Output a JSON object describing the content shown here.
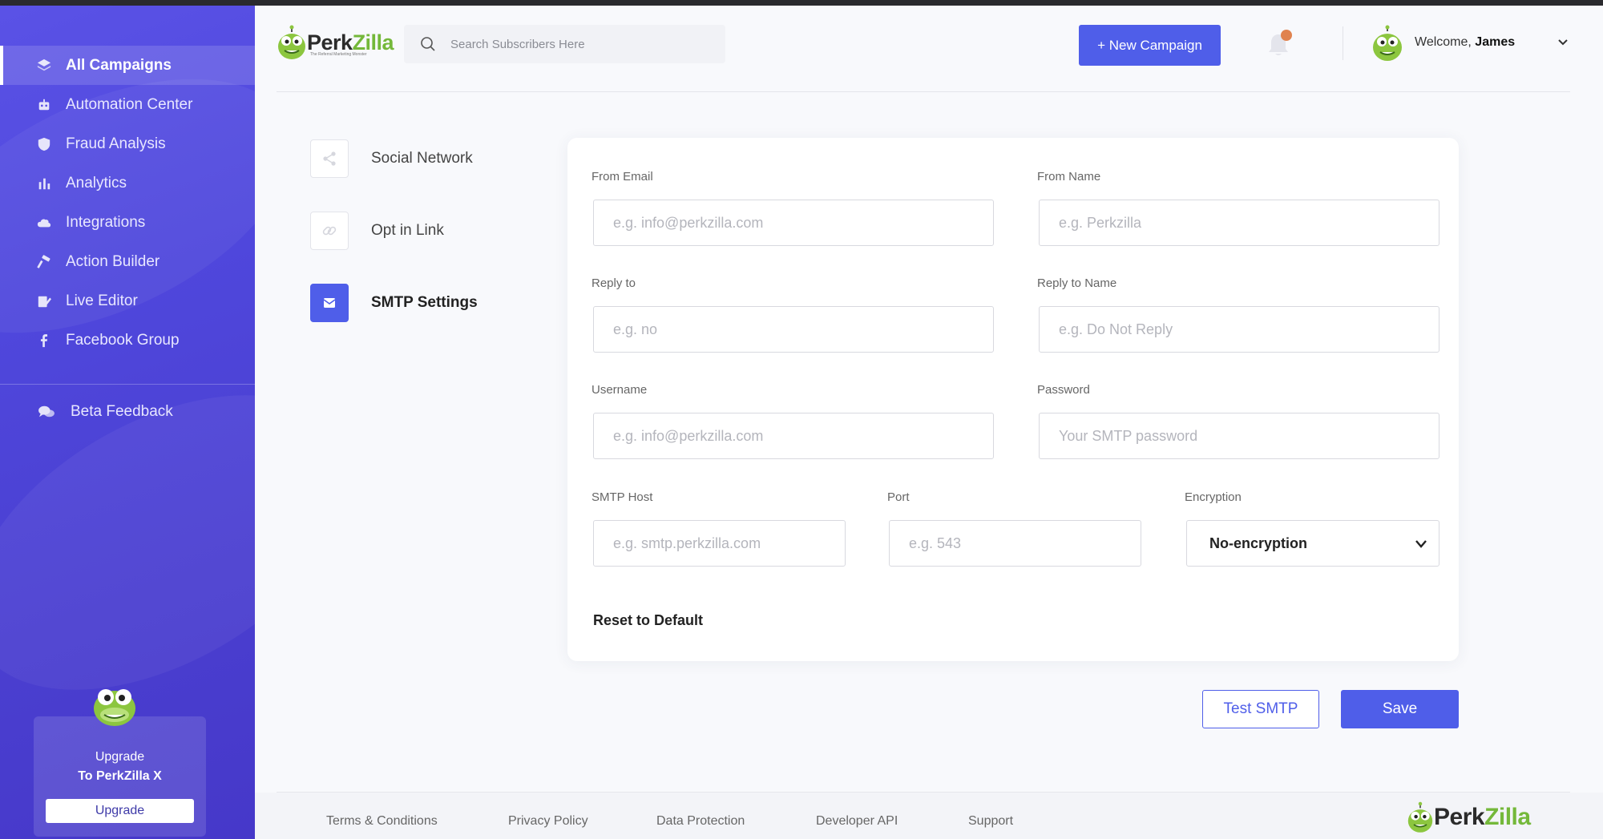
{
  "sidebar": {
    "items": [
      {
        "label": "All Campaigns",
        "icon": "layers-icon"
      },
      {
        "label": "Automation Center",
        "icon": "robot-icon"
      },
      {
        "label": "Fraud Analysis",
        "icon": "shield-icon"
      },
      {
        "label": "Analytics",
        "icon": "bar-chart-icon"
      },
      {
        "label": "Integrations",
        "icon": "cloud-icon"
      },
      {
        "label": "Action Builder",
        "icon": "hammer-icon"
      },
      {
        "label": "Live Editor",
        "icon": "edit-icon"
      },
      {
        "label": "Facebook Group",
        "icon": "facebook-icon"
      }
    ],
    "beta_label": "Beta Feedback",
    "upgrade": {
      "line1": "Upgrade",
      "line2": "To PerkZilla X",
      "button": "Upgrade"
    }
  },
  "header": {
    "logo_perk": "Perk",
    "logo_zilla": "Zilla",
    "logo_tagline": "The Referral Marketing Monster",
    "search_placeholder": "Search Subscribers Here",
    "new_campaign": "+ New Campaign",
    "welcome_prefix": "Welcome,",
    "user_name": "James"
  },
  "settings_menu": [
    {
      "label": "Social Network",
      "icon": "share-icon"
    },
    {
      "label": "Opt in Link",
      "icon": "link-icon"
    },
    {
      "label": "SMTP Settings",
      "icon": "envelope-icon",
      "active": true
    }
  ],
  "form": {
    "from_email": {
      "label": "From Email",
      "placeholder": "e.g. info@perkzilla.com"
    },
    "from_name": {
      "label": "From Name",
      "placeholder": "e.g. Perkzilla"
    },
    "reply_to": {
      "label": "Reply to",
      "placeholder": "e.g. no"
    },
    "reply_to_name": {
      "label": "Reply to Name",
      "placeholder": "e.g. Do Not Reply"
    },
    "username": {
      "label": "Username",
      "placeholder": "e.g. info@perkzilla.com"
    },
    "password": {
      "label": "Password",
      "placeholder": "Your SMTP password"
    },
    "smtp_host": {
      "label": "SMTP Host",
      "placeholder": "e.g. smtp.perkzilla.com"
    },
    "port": {
      "label": "Port",
      "placeholder": "e.g. 543"
    },
    "encryption": {
      "label": "Encryption",
      "value": "No-encryption"
    },
    "reset": "Reset to Default"
  },
  "actions": {
    "test": "Test SMTP",
    "save": "Save"
  },
  "footer": {
    "links": [
      "Terms & Conditions",
      "Privacy Policy",
      "Data Protection",
      "Developer API",
      "Support"
    ],
    "logo_perk": "Perk",
    "logo_zilla": "Zilla"
  },
  "colors": {
    "accent": "#4f5ee9",
    "sidebar": "#4f47dc",
    "notification": "#e0834f",
    "brand_green": "#74b83a"
  }
}
